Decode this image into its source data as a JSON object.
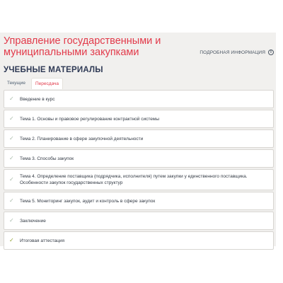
{
  "course": {
    "title": "Управление государственными и муниципальными закупками",
    "more_info_label": "ПОДРОБНАЯ ИНФОРМАЦИЯ",
    "more_info_icon": "info-icon"
  },
  "materials": {
    "heading": "УЧЕБНЫЕ МАТЕРИАЛЫ",
    "tabs": [
      {
        "label": "Текущие",
        "active": false
      },
      {
        "label": "Пересдача",
        "active": true
      }
    ],
    "items": [
      {
        "label": "Введение в курс",
        "status": "check-icon"
      },
      {
        "label": "Тема 1. Основы и правовое регулирование контрактной системы",
        "status": "check-icon"
      },
      {
        "label": "Тема 2. Планирование в сфере закупочной деятельности",
        "status": "check-icon"
      },
      {
        "label": "Тема 3. Способы закупок",
        "status": "check-icon"
      },
      {
        "label": "Тема 4. Определение поставщика (подрядчика, исполнителя) путем закупки у единственного поставщика. Особенности закупок государственных структур",
        "status": "check-icon"
      },
      {
        "label": "Тема 5. Мониторинг закупок, аудит и контроль в сфере закупок",
        "status": "check-icon"
      },
      {
        "label": "Заключение",
        "status": "check-icon"
      },
      {
        "label": "Итоговая аттестация",
        "status": "check-icon-completed"
      }
    ]
  },
  "colors": {
    "accent": "#e23a4a",
    "heading": "#2f3a55",
    "check": "#a7b9a8",
    "check_done": "#8ea12f",
    "panel_bg": "#f1f0ee"
  }
}
